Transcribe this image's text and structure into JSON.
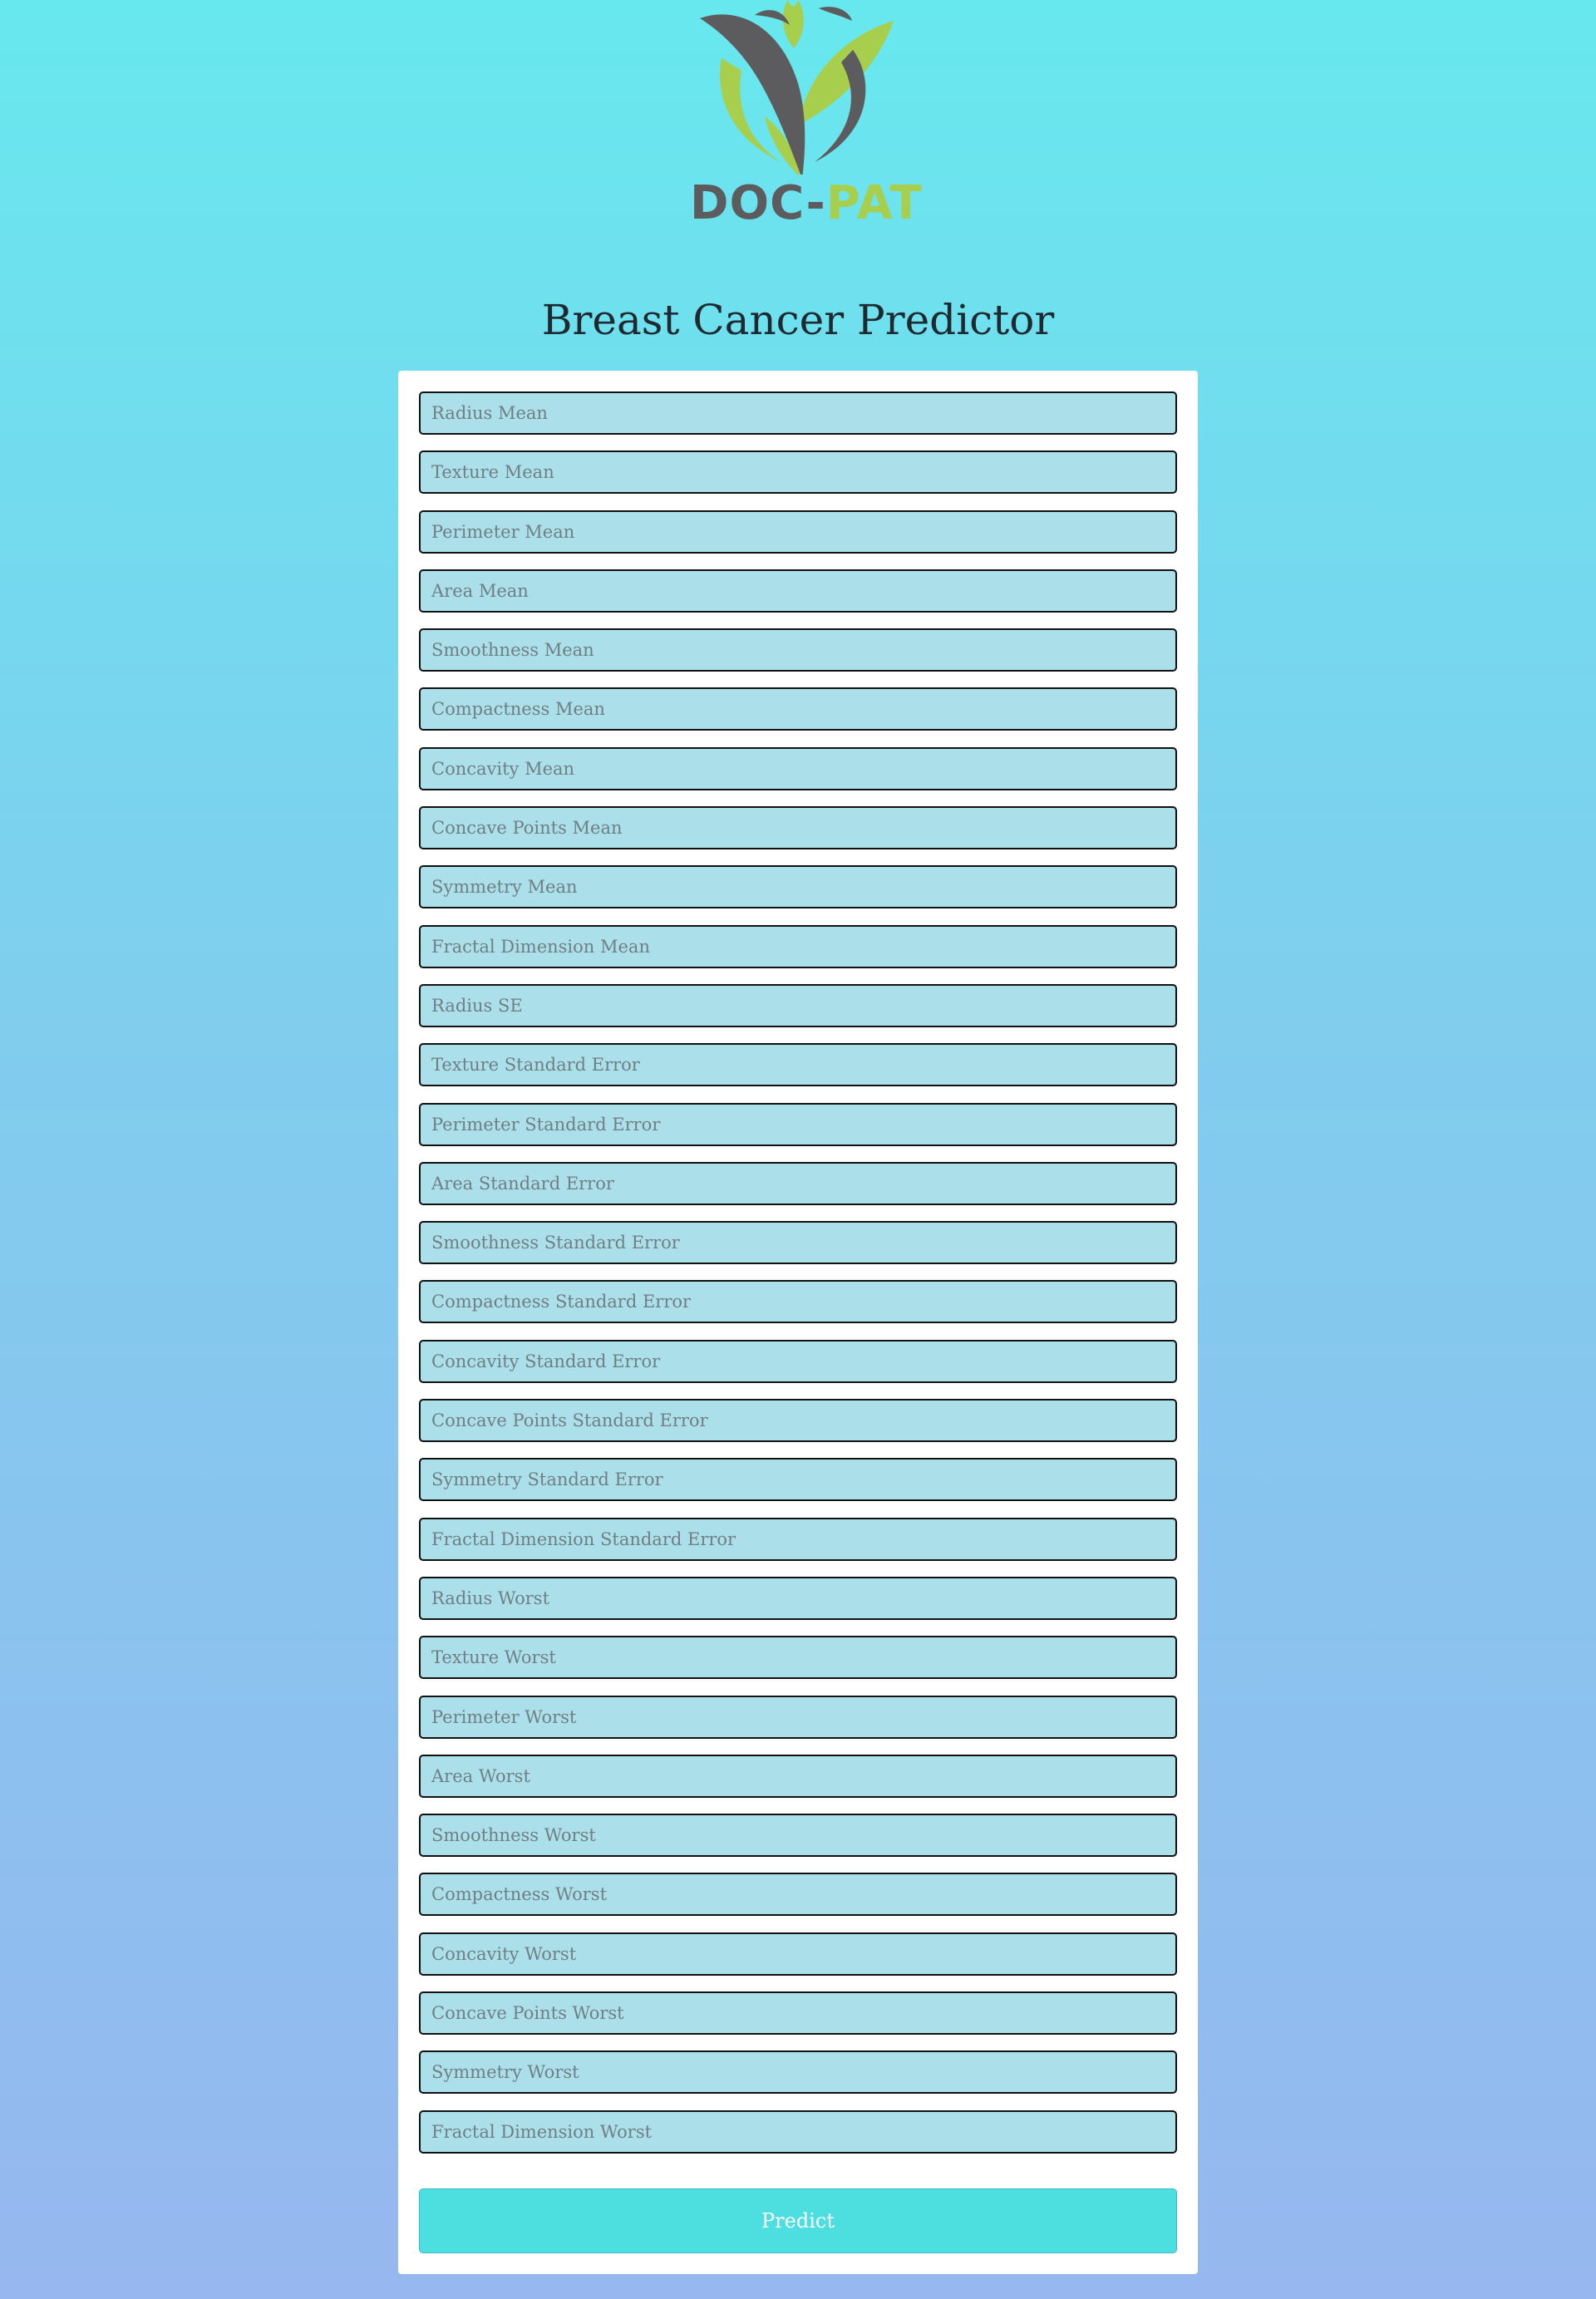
{
  "brand": {
    "name_part1": "DOC-",
    "name_part2": "PAT",
    "logo_icon": "leaf-figure-logo-icon",
    "dark_color": "#5c5c5e",
    "green_color": "#a7cf4d"
  },
  "page": {
    "title": "Breast Cancer Predictor"
  },
  "form": {
    "fields": [
      {
        "placeholder": "Radius Mean",
        "value": ""
      },
      {
        "placeholder": "Texture Mean",
        "value": ""
      },
      {
        "placeholder": "Perimeter Mean",
        "value": ""
      },
      {
        "placeholder": "Area Mean",
        "value": ""
      },
      {
        "placeholder": "Smoothness Mean",
        "value": ""
      },
      {
        "placeholder": "Compactness Mean",
        "value": ""
      },
      {
        "placeholder": "Concavity Mean",
        "value": ""
      },
      {
        "placeholder": "Concave Points Mean",
        "value": ""
      },
      {
        "placeholder": "Symmetry Mean",
        "value": ""
      },
      {
        "placeholder": "Fractal Dimension Mean",
        "value": ""
      },
      {
        "placeholder": "Radius SE",
        "value": ""
      },
      {
        "placeholder": "Texture Standard Error",
        "value": ""
      },
      {
        "placeholder": "Perimeter Standard Error",
        "value": ""
      },
      {
        "placeholder": "Area Standard Error",
        "value": ""
      },
      {
        "placeholder": "Smoothness Standard Error",
        "value": ""
      },
      {
        "placeholder": "Compactness Standard Error",
        "value": ""
      },
      {
        "placeholder": "Concavity Standard Error",
        "value": ""
      },
      {
        "placeholder": "Concave Points Standard Error",
        "value": ""
      },
      {
        "placeholder": "Symmetry Standard Error",
        "value": ""
      },
      {
        "placeholder": "Fractal Dimension Standard Error",
        "value": ""
      },
      {
        "placeholder": "Radius Worst",
        "value": ""
      },
      {
        "placeholder": "Texture Worst",
        "value": ""
      },
      {
        "placeholder": "Perimeter Worst",
        "value": ""
      },
      {
        "placeholder": "Area Worst",
        "value": ""
      },
      {
        "placeholder": "Smoothness Worst",
        "value": ""
      },
      {
        "placeholder": "Compactness Worst",
        "value": ""
      },
      {
        "placeholder": "Concavity Worst",
        "value": ""
      },
      {
        "placeholder": "Concave Points Worst",
        "value": ""
      },
      {
        "placeholder": "Symmetry Worst",
        "value": ""
      },
      {
        "placeholder": "Fractal Dimension Worst",
        "value": ""
      }
    ],
    "submit_label": "Predict"
  },
  "colors": {
    "background_top": "#67e8ee",
    "background_bottom": "#96b7ef",
    "field_background": "#abdfe9",
    "button_background": "#4ddfdf"
  }
}
